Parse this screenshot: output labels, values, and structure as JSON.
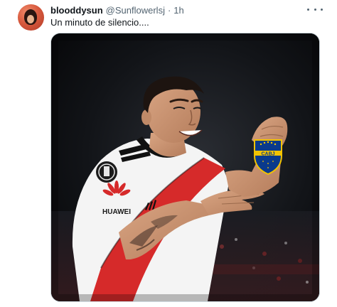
{
  "tweet": {
    "display_name": "blooddysun",
    "handle": "@Sunflowerlsj",
    "separator": "·",
    "time": "1h",
    "text": "Un minuto de silencio....",
    "more_icon": "more-horizontal-icon"
  },
  "media": {
    "jersey_sponsor": "HUAWEI",
    "badge_text": "CABJ"
  }
}
